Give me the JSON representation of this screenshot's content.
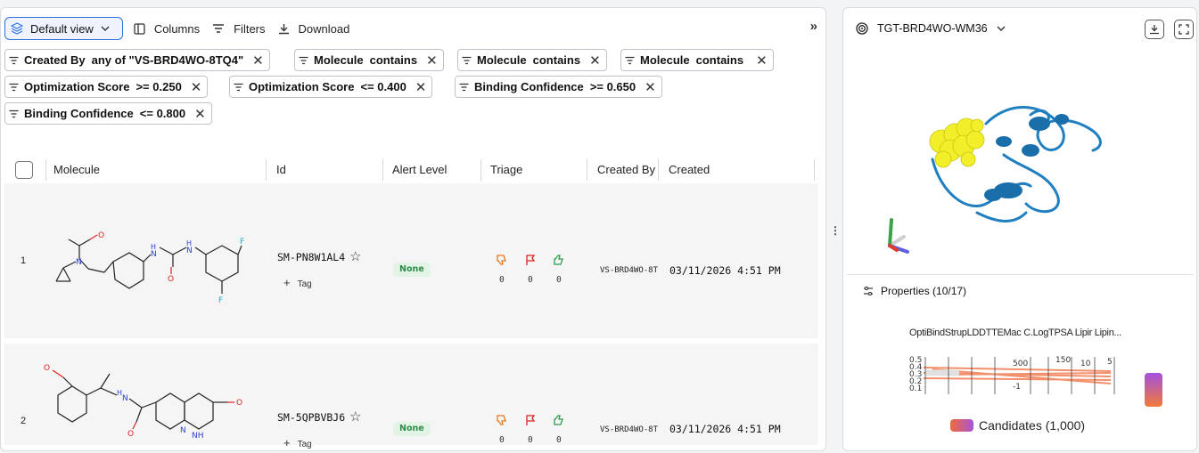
{
  "toolbar": {
    "view_label": "Default view",
    "columns_label": "Columns",
    "filters_label": "Filters",
    "download_label": "Download",
    "collapse_glyph": "»"
  },
  "filters": [
    {
      "field": "Created By",
      "value": "any of \"VS-BRD4WO-8TQ4\""
    },
    {
      "field": "Molecule",
      "value": "contains"
    },
    {
      "field": "Molecule",
      "value": "contains"
    },
    {
      "field": "Molecule",
      "value": "contains"
    },
    {
      "field": "Optimization Score",
      "value": ">= 0.250"
    },
    {
      "field": "Optimization Score",
      "value": "<= 0.400"
    },
    {
      "field": "Binding Confidence",
      "value": ">= 0.650"
    },
    {
      "field": "Binding Confidence",
      "value": "<= 0.800"
    }
  ],
  "table": {
    "columns": [
      "Molecule",
      "Id",
      "Alert Level",
      "Triage",
      "Created By",
      "Created"
    ],
    "rows": [
      {
        "num": "1",
        "id": "SM-PN8W1AL4",
        "tag": "Tag",
        "alert": "None",
        "thumbs_down": "0",
        "flag": "0",
        "thumbs_up": "0",
        "created_by": "VS-BRD4WO-8T",
        "created": "03/11/2026 4:51 PM"
      },
      {
        "num": "2",
        "id": "SM-5QPBVBJ6",
        "tag": "Tag",
        "alert": "None",
        "thumbs_down": "0",
        "flag": "0",
        "thumbs_up": "0",
        "created_by": "VS-BRD4WO-8T",
        "created": "03/11/2026 4:51 PM"
      }
    ]
  },
  "viewer": {
    "target": "TGT-BRD4WO-WM36",
    "properties_label": "Properties (10/17)",
    "pc_axes": "OptiBindStrupLDDTTEMac C.LogTPSA Lipir Lipin...",
    "legend_label": "Candidates (1,000)"
  },
  "colors": {
    "accent": "#2f6fe0",
    "badge_bg": "#e2f4e6",
    "badge_fg": "#2f8c48",
    "protein": "#1f7fc0",
    "ligand": "#f2ef2a"
  }
}
